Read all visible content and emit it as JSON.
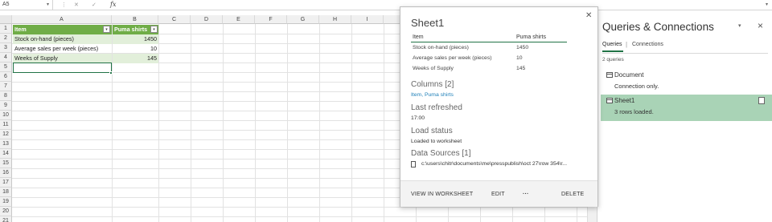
{
  "formula_bar": {
    "name_box": "A5",
    "fx": "fx"
  },
  "grid": {
    "columns": [
      "A",
      "B",
      "C",
      "D",
      "E",
      "F",
      "G",
      "H",
      "I"
    ],
    "rows": [
      "1",
      "2",
      "3",
      "4",
      "5",
      "6",
      "7",
      "8",
      "9",
      "10",
      "11",
      "12",
      "13",
      "14",
      "15",
      "16",
      "17",
      "18",
      "19",
      "20",
      "21"
    ],
    "table": {
      "headers": [
        "Item",
        "Puma shirts"
      ],
      "rows": [
        [
          "Stock on-hand (pieces)",
          "1450"
        ],
        [
          "Average sales per week (pieces)",
          "10"
        ],
        [
          "Weeks of Supply",
          "145"
        ]
      ]
    }
  },
  "popup": {
    "title": "Sheet1",
    "preview_headers": [
      "Item",
      "Puma shirts"
    ],
    "preview_rows": [
      [
        "Stock on-hand (pieces)",
        "1450"
      ],
      [
        "Average sales per week (pieces)",
        "10"
      ],
      [
        "Weeks of Supply",
        "145"
      ]
    ],
    "columns_label": "Columns",
    "columns_count": "[2]",
    "columns_value": "Item, Puma shirts",
    "last_refreshed_label": "Last refreshed",
    "last_refreshed_value": "17:00",
    "load_status_label": "Load status",
    "load_status_value": "Loaded to worksheet",
    "data_sources_label": "Data Sources",
    "data_sources_count": "[1]",
    "data_source_path": "c:\\users\\chitr\\documents\\me\\presspublish\\oct 27\\row 354\\r...",
    "view_btn": "VIEW IN WORKSHEET",
    "edit_btn": "EDIT",
    "more_btn": "···",
    "delete_btn": "DELETE"
  },
  "queries_pane": {
    "title": "Queries & Connections",
    "tab_queries": "Queries",
    "tab_connections": "Connections",
    "count": "2 queries",
    "items": [
      {
        "name": "Document",
        "sub": "Connection only."
      },
      {
        "name": "Sheet1",
        "sub": "3 rows loaded."
      }
    ]
  }
}
